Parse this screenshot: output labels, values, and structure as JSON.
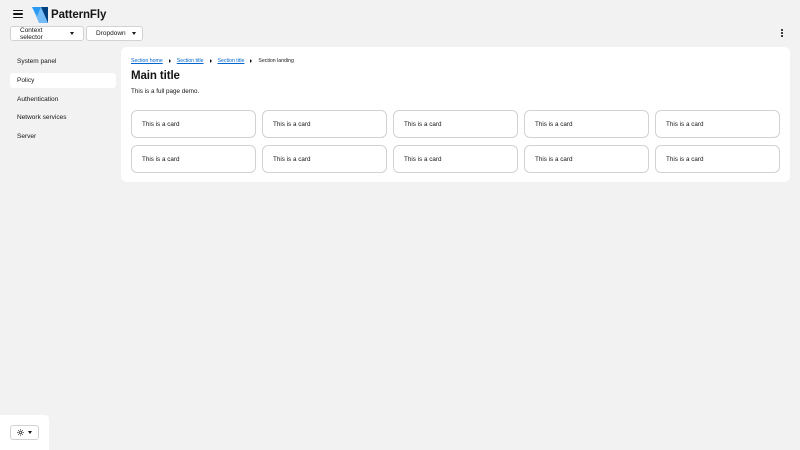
{
  "masthead": {
    "brand_name": "PatternFly",
    "context_selector_label": "Context selector",
    "dropdown_label": "Dropdown"
  },
  "sidebar": {
    "items": [
      {
        "label": "System panel",
        "active": false
      },
      {
        "label": "Policy",
        "active": true
      },
      {
        "label": "Authentication",
        "active": false
      },
      {
        "label": "Network services",
        "active": false
      },
      {
        "label": "Server",
        "active": false
      }
    ]
  },
  "breadcrumb": {
    "items": [
      "Section home",
      "Section title",
      "Section title",
      "Section landing"
    ]
  },
  "main": {
    "title": "Main title",
    "description": "This is a full page demo.",
    "cards": [
      "This is a card",
      "This is a card",
      "This is a card",
      "This is a card",
      "This is a card",
      "This is a card",
      "This is a card",
      "This is a card",
      "This is a card",
      "This is a card"
    ]
  },
  "colors": {
    "background": "#f2f2f2",
    "surface": "#ffffff",
    "border": "#d2d2d2",
    "link": "#0066cc",
    "text": "#151515",
    "logo_dark": "#004080",
    "logo_mid": "#2b9af3",
    "logo_light": "#73bcf7"
  },
  "icons": {
    "nav_toggle": "hamburger-icon",
    "theme": "sun-icon",
    "overflow": "kebab-icon"
  }
}
